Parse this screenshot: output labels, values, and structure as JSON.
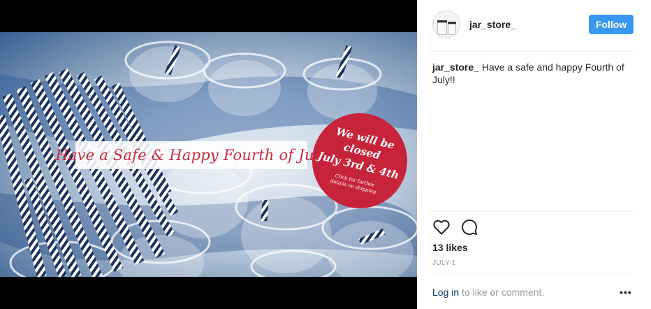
{
  "post": {
    "image": {
      "banner_text": "Have a Safe & Happy Fourth of July",
      "badge_line1": "We will be closed",
      "badge_line2": "July 3rd & 4th",
      "badge_line3": "Click for further details on shipping",
      "colors": {
        "badge": "#c7233a",
        "banner_text": "#c62b38",
        "table": "#3a5f93"
      }
    },
    "header": {
      "username": "jar_store_",
      "follow_label": "Follow"
    },
    "caption": {
      "username": "jar_store_",
      "text": "Have a safe and happy Fourth of July!!"
    },
    "actions": {
      "like_icon": "heart-icon",
      "comment_icon": "comment-icon"
    },
    "likes": "13 likes",
    "date": "JULY 1",
    "footer": {
      "login_label": "Log in",
      "rest": " to like or comment.",
      "more_icon": "more-options-icon"
    },
    "colors": {
      "accent": "#3897f0",
      "link": "#003569",
      "muted": "#999999"
    }
  }
}
